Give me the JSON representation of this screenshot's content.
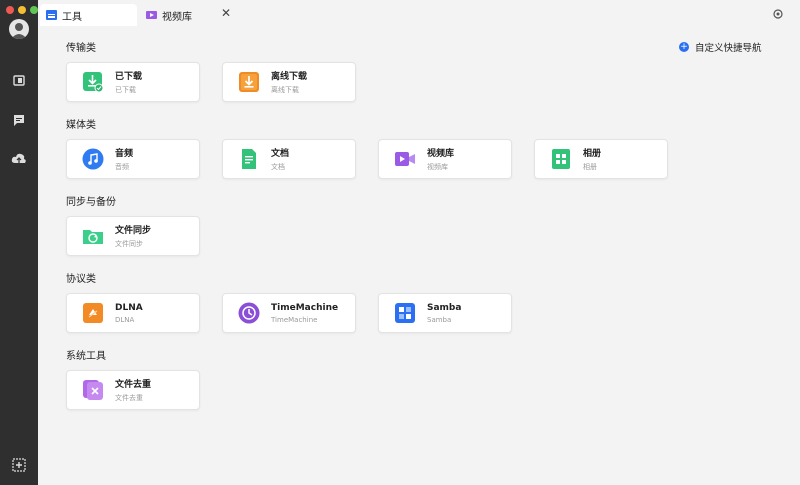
{
  "tabs": [
    {
      "label": "工具",
      "icon": "toolbox-icon"
    },
    {
      "label": "视频库",
      "icon": "video-library-icon"
    }
  ],
  "custom_nav_label": "自定义快捷导航",
  "sections": [
    {
      "title": "传输类",
      "items": [
        {
          "name": "已下载",
          "sub": "已下载",
          "icon": "downloaded-icon",
          "color": "#33c27a"
        },
        {
          "name": "离线下载",
          "sub": "离线下载",
          "icon": "offline-download-icon",
          "color": "#f08c25"
        }
      ]
    },
    {
      "title": "媒体类",
      "items": [
        {
          "name": "音频",
          "sub": "音频",
          "icon": "music-icon",
          "color": "#2f7bf2"
        },
        {
          "name": "文档",
          "sub": "文档",
          "icon": "document-icon",
          "color": "#33c27a"
        },
        {
          "name": "视频库",
          "sub": "视频库",
          "icon": "video-icon",
          "color": "#9a5ae6"
        },
        {
          "name": "相册",
          "sub": "相册",
          "icon": "album-icon",
          "color": "#33c27a"
        }
      ]
    },
    {
      "title": "同步与备份",
      "items": [
        {
          "name": "文件同步",
          "sub": "文件同步",
          "icon": "folder-sync-icon",
          "color": "#3bcf8b"
        }
      ]
    },
    {
      "title": "协议类",
      "items": [
        {
          "name": "DLNA",
          "sub": "DLNA",
          "icon": "dlna-icon",
          "color": "#f28a25"
        },
        {
          "name": "TimeMachine",
          "sub": "TimeMachine",
          "icon": "time-machine-icon",
          "color": "#8a4fd6"
        },
        {
          "name": "Samba",
          "sub": "Samba",
          "icon": "samba-icon",
          "color": "#2b6ff2"
        }
      ]
    },
    {
      "title": "系统工具",
      "items": [
        {
          "name": "文件去重",
          "sub": "文件去重",
          "icon": "dedupe-icon",
          "color": "#b06ae8"
        }
      ]
    }
  ]
}
